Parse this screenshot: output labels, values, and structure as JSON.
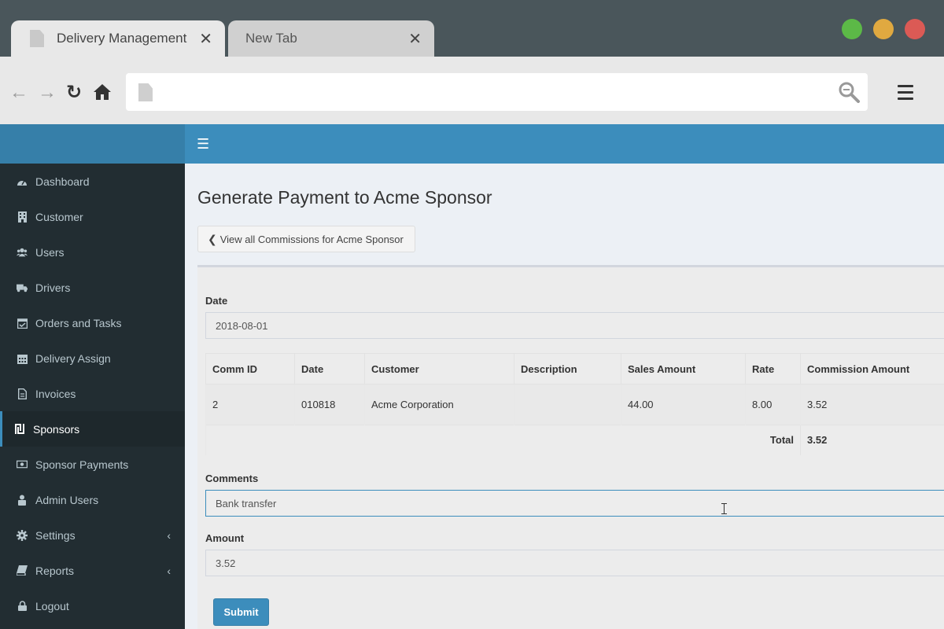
{
  "browser": {
    "tabs": [
      {
        "label": "Delivery Management",
        "close": "✕"
      },
      {
        "label": "New Tab",
        "close": "✕"
      }
    ],
    "url": "",
    "colors": {
      "min": "#5cb947",
      "max": "#e0a940",
      "close": "#db5a55"
    }
  },
  "sidebar": {
    "items": [
      {
        "label": "Dashboard",
        "icon": "dashboard-icon"
      },
      {
        "label": "Customer",
        "icon": "building-icon"
      },
      {
        "label": "Users",
        "icon": "users-icon"
      },
      {
        "label": "Drivers",
        "icon": "truck-icon"
      },
      {
        "label": "Orders and Tasks",
        "icon": "calendar-check-icon"
      },
      {
        "label": "Delivery Assign",
        "icon": "calendar-icon"
      },
      {
        "label": "Invoices",
        "icon": "file-icon"
      },
      {
        "label": "Sponsors",
        "icon": "shekel-icon",
        "active": true
      },
      {
        "label": "Sponsor Payments",
        "icon": "money-icon"
      },
      {
        "label": "Admin Users",
        "icon": "lock-user-icon"
      },
      {
        "label": "Settings",
        "icon": "gear-icon",
        "chevron": "‹"
      },
      {
        "label": "Reports",
        "icon": "book-icon",
        "chevron": "‹"
      },
      {
        "label": "Logout",
        "icon": "lock-icon"
      }
    ]
  },
  "main": {
    "title": "Generate Payment to Acme Sponsor",
    "back_button": "View all Commissions for Acme Sponsor",
    "date_label": "Date",
    "date_value": "2018-08-01",
    "table": {
      "headers": [
        "Comm ID",
        "Date",
        "Customer",
        "Description",
        "Sales Amount",
        "Rate",
        "Commission Amount"
      ],
      "rows": [
        [
          "2",
          "010818",
          "Acme Corporation",
          "",
          "44.00",
          "8.00",
          "3.52"
        ]
      ],
      "total_label": "Total",
      "total_value": "3.52"
    },
    "comments_label": "Comments",
    "comments_value": "Bank transfer",
    "amount_label": "Amount",
    "amount_value": "3.52",
    "submit_label": "Submit"
  },
  "colors": {
    "topbar": "#3c8dbc",
    "brand": "#367fa9",
    "sidebar": "#222d32",
    "content": "#ecf0f5"
  }
}
